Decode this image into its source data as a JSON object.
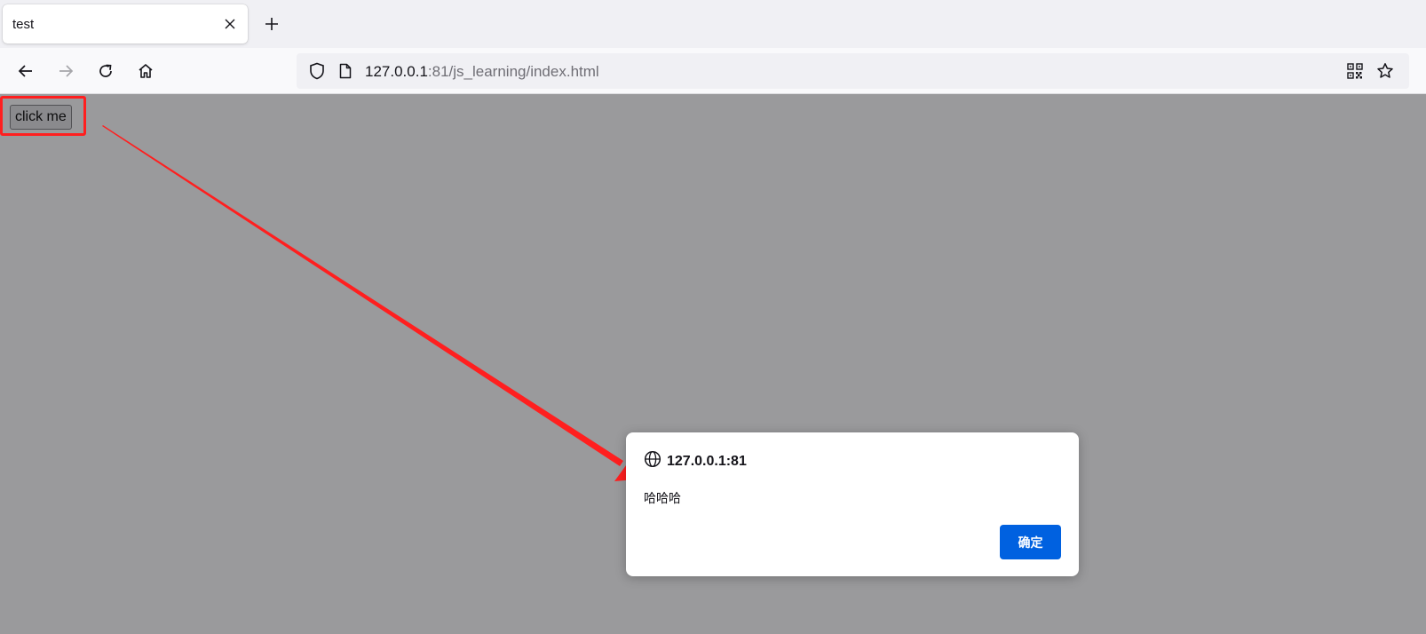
{
  "browser": {
    "tab": {
      "title": "test",
      "close_icon": "close-icon"
    },
    "new_tab_icon": "plus-icon",
    "nav": {
      "back_icon": "back-arrow-icon",
      "forward_icon": "forward-arrow-icon",
      "reload_icon": "reload-icon",
      "home_icon": "home-icon"
    },
    "urlbar": {
      "host": "127.0.0.1",
      "rest": ":81/js_learning/index.html",
      "shield_icon": "shield-icon",
      "page_icon": "page-icon",
      "qr_icon": "qr-code-icon",
      "bookmark_icon": "star-icon"
    }
  },
  "page": {
    "button_label": "click me"
  },
  "annotation": {
    "color": "#ff1f1f"
  },
  "dialog": {
    "origin": "127.0.0.1:81",
    "origin_icon": "globe-icon",
    "message": "哈哈哈",
    "ok_label": "确定",
    "ok_color": "#0061e0"
  }
}
